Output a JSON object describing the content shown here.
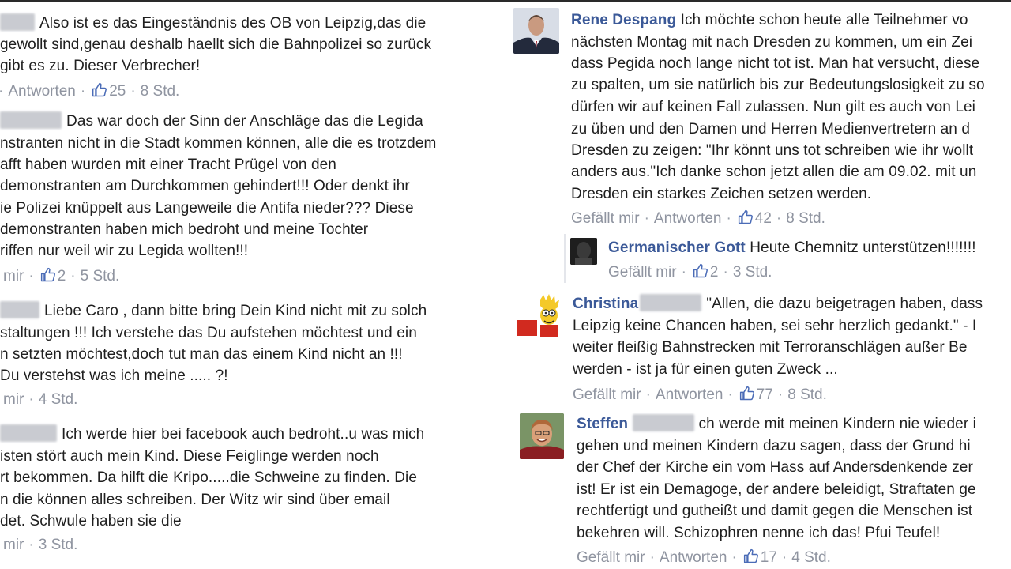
{
  "left_comments": [
    {
      "lines": [
        "Also ist es das Eingeständnis des OB von Leipzig,das die",
        "gewollt sind,genau deshalb haellt sich die Bahnpolizei so zurück",
        "gibt es zu. Dieser Verbrecher!"
      ],
      "meta": {
        "reply": "Antworten",
        "likes": "25",
        "time": "8 Std."
      }
    },
    {
      "lines": [
        "Das war doch der Sinn der Anschläge das die Legida",
        "nstranten nicht in die Stadt kommen können, alle die es trotzdem",
        "afft haben wurden mit einer Tracht Prügel von den",
        "demonstranten am Durchkommen gehindert!!! Oder denkt ihr",
        "ie Polizei knüppelt aus Langeweile die Antifa nieder??? Diese",
        "demonstranten haben mich bedroht und meine Tochter",
        "riffen nur weil wir zu Legida wollten!!!"
      ],
      "meta": {
        "like": "mir",
        "likes": "2",
        "time": "5 Std."
      }
    },
    {
      "lines": [
        "Liebe Caro , dann bitte bring Dein Kind nicht mit zu solch",
        "staltungen !!! Ich verstehe das Du aufstehen möchtest und ein",
        "n setzten möchtest,doch tut man das einem Kind nicht an !!!",
        "Du verstehst was ich meine ..... ?!"
      ],
      "meta": {
        "like": "mir",
        "time": "4 Std."
      }
    },
    {
      "lines": [
        "Ich werde hier bei facebook auch bedroht..u was mich",
        "isten stört auch mein Kind. Diese Feiglinge werden noch",
        "rt bekommen. Da hilft die Kripo.....die Schweine zu finden. Die",
        "n die können alles schreiben. Der Witz wir sind über email",
        "det. Schwule haben sie die"
      ],
      "meta": {
        "like": "mir",
        "time": "3 Std."
      }
    }
  ],
  "right_comments": [
    {
      "author": "Rene Despang",
      "lines": [
        "Ich möchte schon heute alle Teilnehmer vo",
        "nächsten Montag mit nach Dresden zu kommen, um ein Zei",
        "dass Pegida noch lange nicht tot ist. Man hat versucht, diese",
        "zu spalten, um sie natürlich bis zur Bedeutungslosigkeit zu so",
        "dürfen wir auf keinen Fall zulassen. Nun gilt es auch von Lei",
        "zu üben und den Damen und Herren Medienvertretern an d",
        "Dresden zu zeigen: \"Ihr könnt uns tot schreiben wie ihr wollt",
        "anders aus.\"Ich danke schon jetzt allen die am 09.02. mit un",
        "Dresden ein starkes Zeichen setzen werden."
      ],
      "meta": {
        "like": "Gefällt mir",
        "reply": "Antworten",
        "likes": "42",
        "time": "8 Std."
      }
    },
    {
      "author": "Germanischer Gott",
      "lines": [
        "Heute Chemnitz unterstützen!!!!!!!"
      ],
      "meta": {
        "like": "Gefällt mir",
        "likes": "2",
        "time": "3 Std."
      }
    },
    {
      "author": "Christina",
      "lines": [
        "\"Allen, die dazu beigetragen haben, dass",
        "Leipzig keine Chancen haben, sei sehr herzlich gedankt.\" - I",
        "weiter fleißig Bahnstrecken mit Terroranschlägen außer Be",
        "werden - ist ja für einen guten Zweck ..."
      ],
      "meta": {
        "like": "Gefällt mir",
        "reply": "Antworten",
        "likes": "77",
        "time": "8 Std."
      }
    },
    {
      "author": "Steffen",
      "lines": [
        "ch werde mit meinen Kindern nie wieder i",
        "gehen und meinen Kindern dazu sagen, dass der Grund hi",
        "der Chef der Kirche ein vom Hass auf Andersdenkende zer",
        "ist! Er ist ein Demagoge, der andere beleidigt, Straftaten ge",
        "rechtfertigt und gutheißt und damit gegen die Menschen ist",
        "bekehren will. Schizophren nenne ich das! Pfui Teufel!"
      ],
      "meta": {
        "like": "Gefällt mir",
        "reply": "Antworten",
        "likes": "17",
        "time": "4 Std."
      }
    }
  ],
  "icons": {
    "like": "thumbs-up-icon"
  },
  "colors": {
    "name": "#3b5998",
    "meta": "#8f94a0",
    "text": "#1f1f1f"
  }
}
